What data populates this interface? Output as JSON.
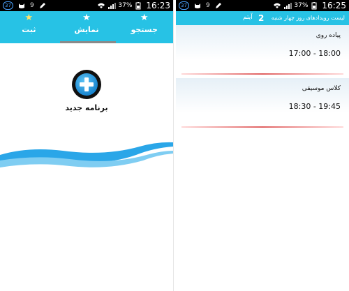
{
  "left_screen": {
    "status_bar": {
      "badge": "37",
      "signal_label": "9",
      "battery": "37%",
      "time": "16:23"
    },
    "tabs": [
      {
        "label": "ثبت",
        "icon": "star-icon",
        "active": true
      },
      {
        "label": "نمایش",
        "icon": "star-icon",
        "active": false
      },
      {
        "label": "جستجو",
        "icon": "star-icon",
        "active": false
      }
    ],
    "new_program": {
      "icon": "plus-circle-icon",
      "label": "برنامه جدید"
    }
  },
  "right_screen": {
    "status_bar": {
      "badge": "37",
      "signal_label": "9",
      "battery": "37%",
      "time": "16:25"
    },
    "title_bar": {
      "title": "لیست رویدادهای روز  چهار شنبه",
      "count": "2",
      "unit": "آیتم"
    },
    "events": [
      {
        "name": "پیاده روی",
        "time": "17:00 - 18:00"
      },
      {
        "name": "کلاس موسیقی",
        "time": "18:30 - 19:45"
      }
    ]
  },
  "colors": {
    "accent": "#27c2e5",
    "active_star": "#ffe36a",
    "wave": "#2aa6e8",
    "status_bar": "#000000"
  }
}
